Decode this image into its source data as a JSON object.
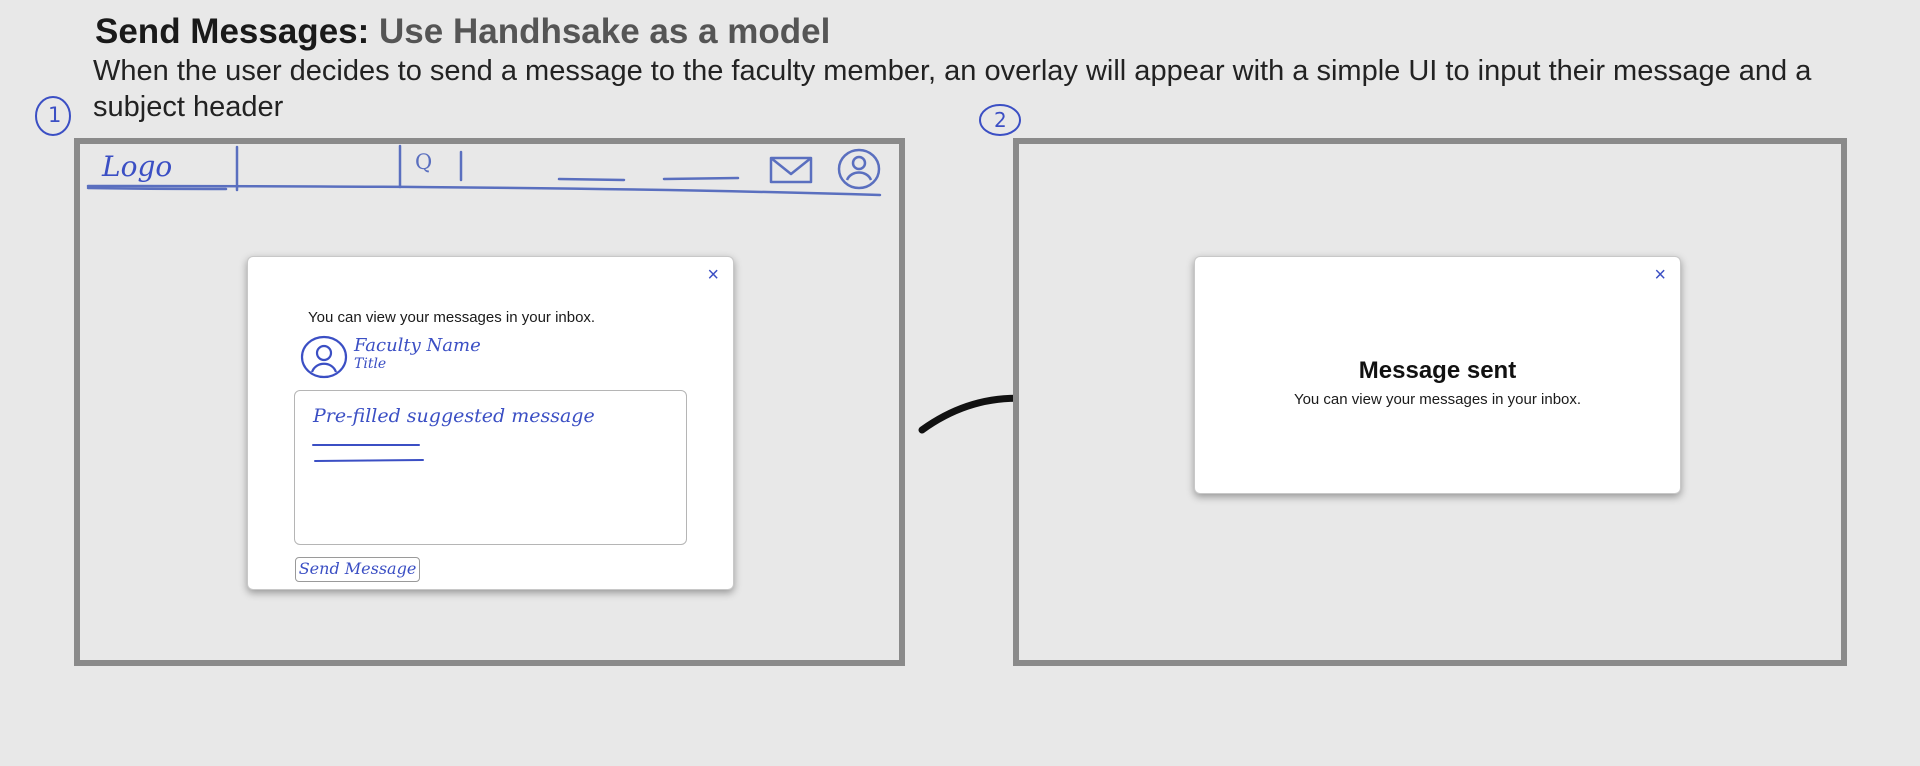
{
  "heading": {
    "title_main": "Send Messages:",
    "title_accent": "Use Handhsake as a model",
    "description": "When the user decides to send a message to the faculty member, an overlay will appear with a simple UI to input their message and a subject header"
  },
  "steps": {
    "one": "1",
    "two": "2"
  },
  "wireframe1": {
    "header": {
      "logo": "Logo",
      "search_glyph": "Q"
    },
    "modal": {
      "close": "×",
      "info": "You can view your messages in your inbox.",
      "faculty_name": "Faculty Name",
      "faculty_title": "Title",
      "prefilled_message": "Pre-filled suggested message",
      "send_label": "Send Message"
    }
  },
  "wireframe2": {
    "modal": {
      "close": "×",
      "title": "Message sent",
      "body": "You can view your messages in your inbox."
    }
  },
  "colors": {
    "sketch": "#3b4fc4",
    "frame": "#8a8a8a",
    "background": "#e8e8e8"
  }
}
